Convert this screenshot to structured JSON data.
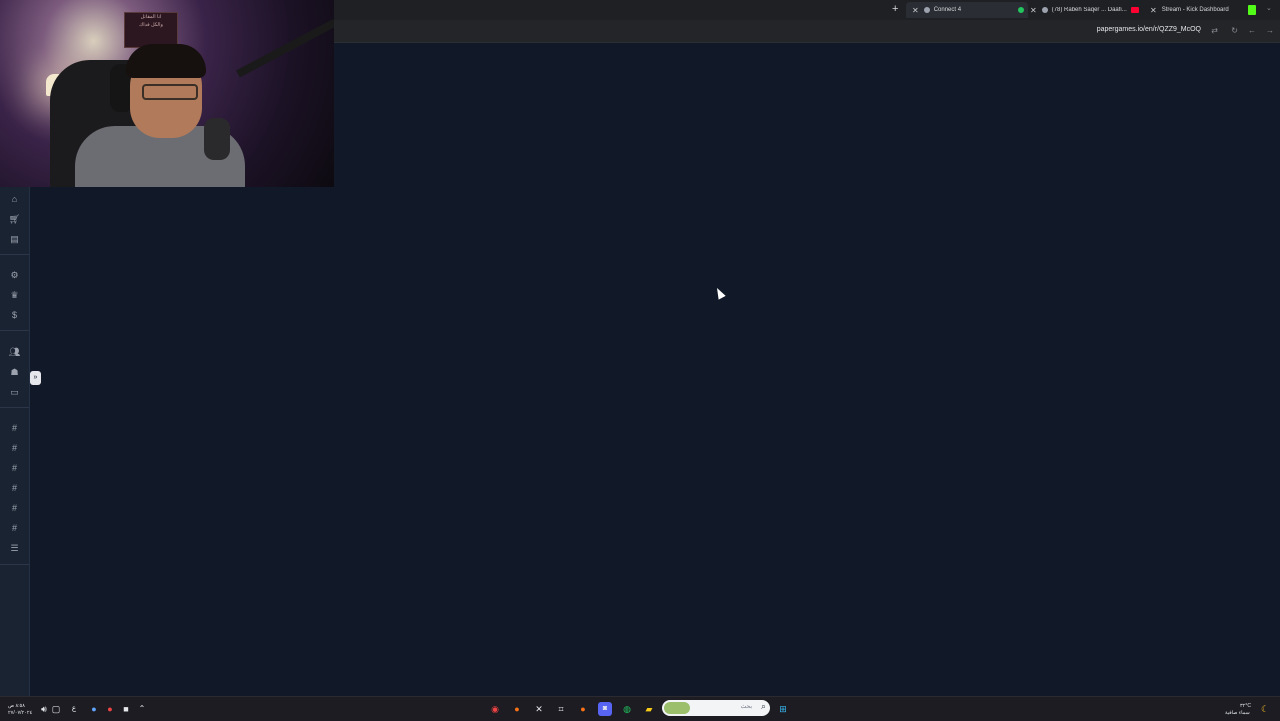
{
  "browser": {
    "new_tab_symbol": "+",
    "tabs": [
      {
        "title": "Connect 4",
        "close": "✕",
        "favicon": "papergames-icon",
        "active": true
      },
      {
        "title": "(78) Rabeh Saqer ... Daafi...",
        "close": "✕",
        "favicon": "youtube-icon",
        "active": false
      },
      {
        "title": "Stream - Kick Dashboard",
        "close": "✕",
        "favicon": "kick-icon",
        "active": false
      }
    ],
    "url": "papergames.io/en/r/QZZ9_McOQ",
    "colors": {
      "kick": "#53fc18",
      "youtube": "#ff0033",
      "connect_dot": "#22c55e"
    }
  },
  "webcam": {
    "poster_line1": "انا المقاتل",
    "poster_line2": "والكل فداك"
  },
  "sidebar": {
    "icons": [
      "home-icon",
      "cart-icon",
      "gift-icon",
      "settings-icon",
      "trophy-icon",
      "dollar-icon",
      "users-icon",
      "robot-icon",
      "controller-icon",
      "hash-icon",
      "hash-icon",
      "hash-icon",
      "hash-icon",
      "hash-icon",
      "hash-icon",
      "list-icon"
    ],
    "collapse_symbol": "»"
  },
  "taskbar": {
    "search_text": "بحث",
    "left_time": "٨:٥٨ ص",
    "left_date": "٢٧/٠٧/٢٠٢٤",
    "lang": "ع",
    "weather_temp": "٣٢°C",
    "weather_desc": "سماء صافية"
  }
}
